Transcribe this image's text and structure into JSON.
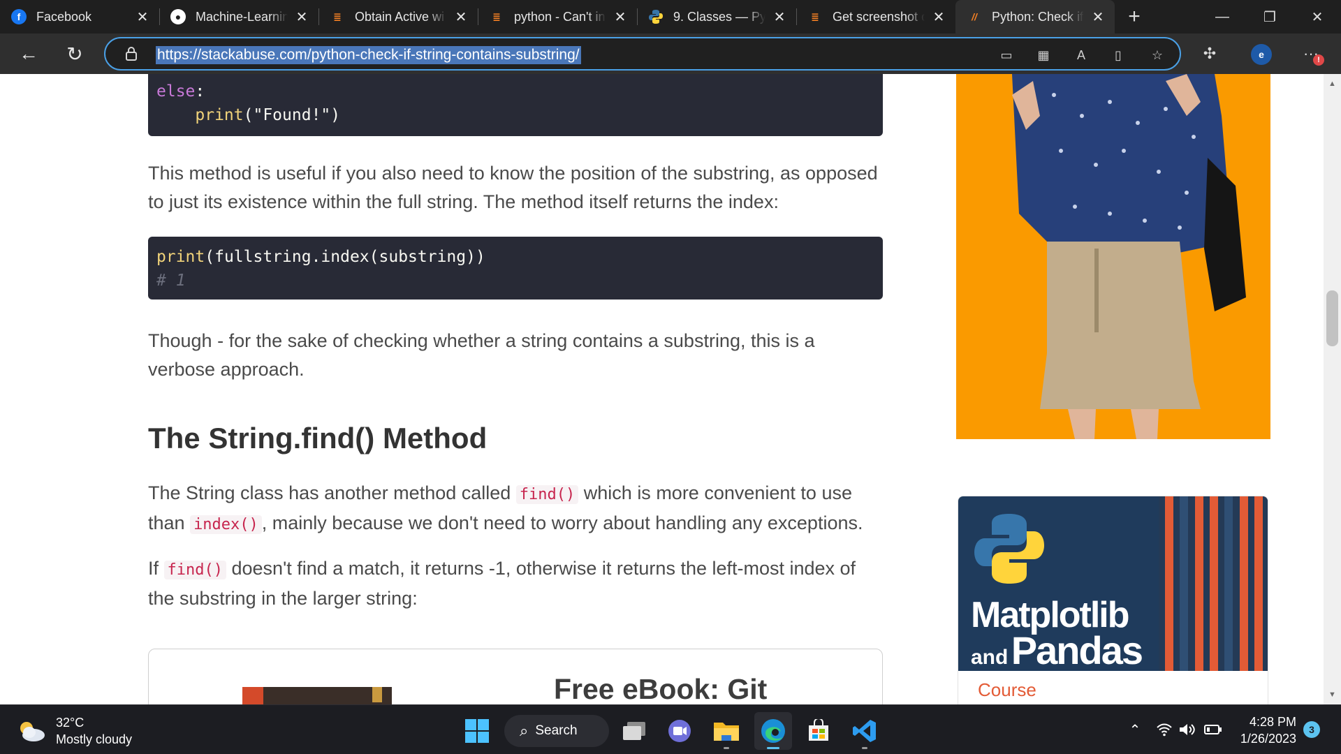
{
  "browser": {
    "tabs": [
      {
        "title": "Facebook",
        "icon": "facebook-icon",
        "color": "#1877f2"
      },
      {
        "title": "Machine-Learnin",
        "icon": "github-icon",
        "color": "#ffffff"
      },
      {
        "title": "Obtain Active wi",
        "icon": "stackoverflow-icon",
        "color": "#f48024"
      },
      {
        "title": "python - Can't in",
        "icon": "stackoverflow-icon",
        "color": "#f48024"
      },
      {
        "title": "9. Classes — Pyt",
        "icon": "python-icon",
        "color": "#ffd43b"
      },
      {
        "title": "Get screenshot o",
        "icon": "stackoverflow-icon",
        "color": "#f48024"
      },
      {
        "title": "Python: Check if",
        "icon": "stackabuse-icon",
        "color": "#f48024",
        "active": true
      }
    ],
    "url": "https://stackabuse.com/python-check-if-string-contains-substring/"
  },
  "article": {
    "code1": {
      "else_kw": "else",
      "colon": ":",
      "print_fn": "print",
      "print_arg": "(\"Found!\")"
    },
    "para1": "This method is useful if you also need to know the position of the substring, as opposed to just its existence within the full string. The method itself returns the index:",
    "code2": {
      "print_fn": "print",
      "expr": "(fullstring.index(substring))",
      "comment": "# 1"
    },
    "para2": "Though - for the sake of checking whether a string contains a substring, this is a verbose approach.",
    "heading": "The String.find() Method",
    "para3": {
      "part1": "The String class has another method called ",
      "code1": "find()",
      "part2": " which is more convenient to use than ",
      "code2": "index()",
      "part3": ", mainly because we don't need to worry about handling any exceptions."
    },
    "para4": {
      "part1": "If ",
      "code1": "find()",
      "part2": " doesn't find a match, it returns -1, otherwise it returns the left-most index of the substring in the larger string:"
    },
    "ebook_title": "Free eBook: Git"
  },
  "sidebar": {
    "ad_color": "#fa9a00",
    "course": {
      "title_line1": "Matplotlib",
      "title_and": "and",
      "title_line2": "Pandas",
      "link": "Course"
    }
  },
  "taskbar": {
    "weather_temp": "32°C",
    "weather_desc": "Mostly cloudy",
    "search_label": "Search",
    "time": "4:28 PM",
    "date": "1/26/2023",
    "notifications": "3"
  }
}
